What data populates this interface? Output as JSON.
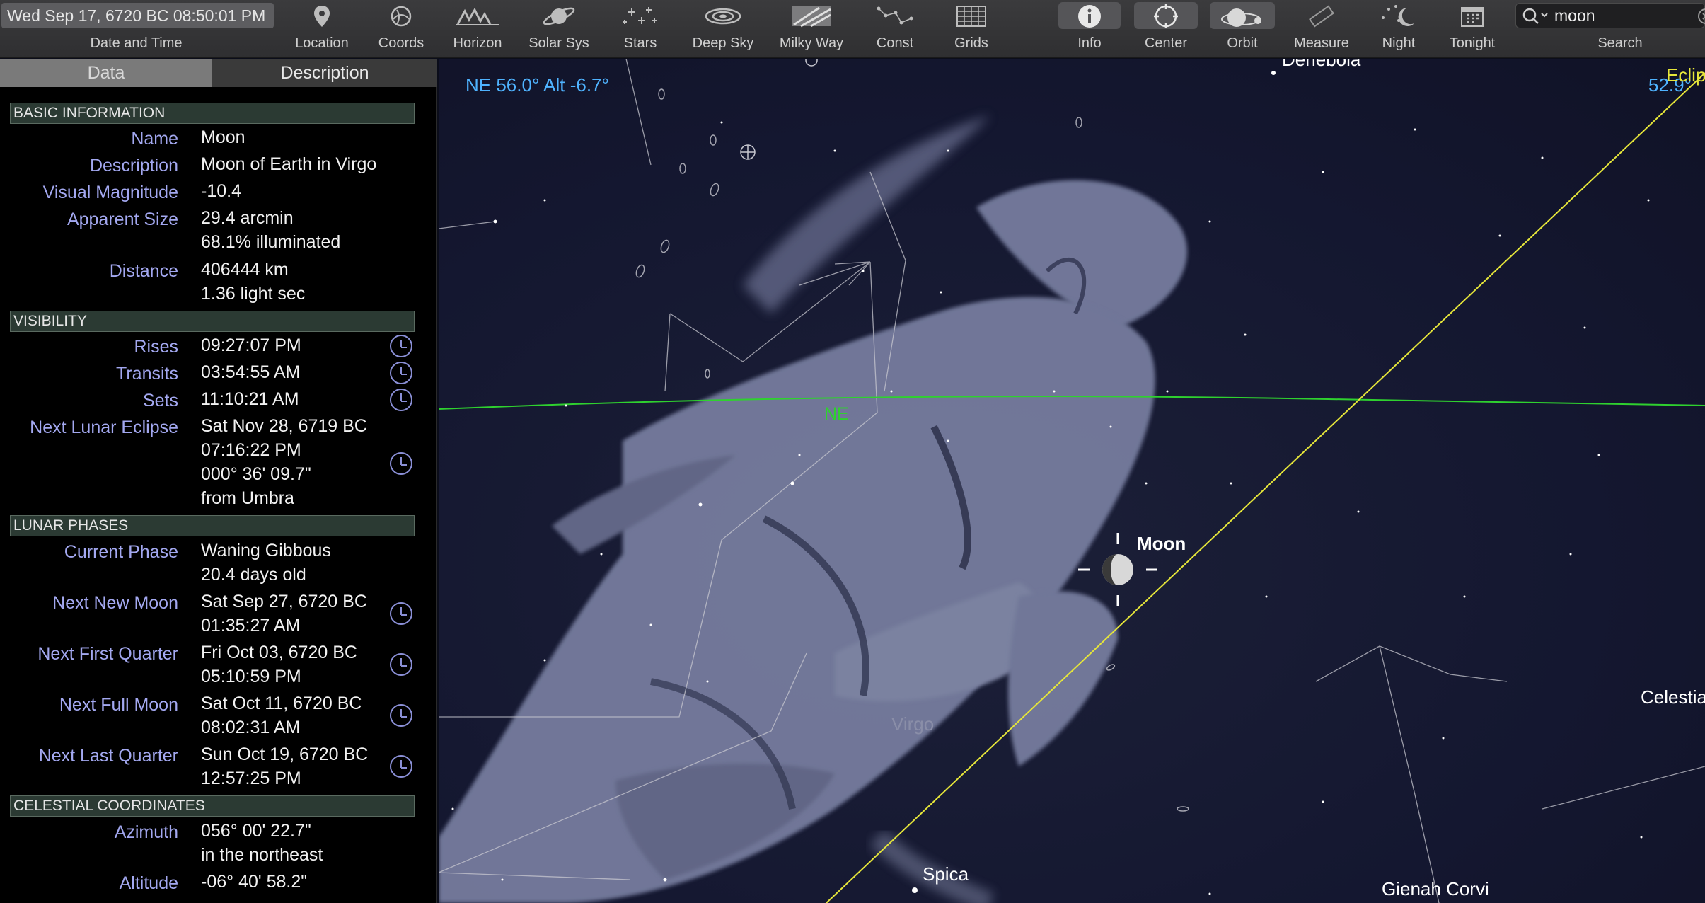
{
  "toolbar": {
    "datetime": "Wed Sep 17, 6720 BC 08:50:01 PM",
    "datetime_caption": "Date and Time",
    "buttons": [
      {
        "label": "Location",
        "icon": "location-pin-icon"
      },
      {
        "label": "Coords",
        "icon": "coordinates-icon"
      },
      {
        "label": "Horizon",
        "icon": "horizon-icon"
      },
      {
        "label": "Solar Sys",
        "icon": "planet-icon"
      },
      {
        "label": "Stars",
        "icon": "stars-icon"
      },
      {
        "label": "Deep Sky",
        "icon": "galaxy-icon"
      },
      {
        "label": "Milky Way",
        "icon": "milky-way-icon"
      },
      {
        "label": "Const",
        "icon": "constellation-icon"
      },
      {
        "label": "Grids",
        "icon": "grid-icon"
      },
      {
        "label": "Info",
        "icon": "info-icon"
      },
      {
        "label": "Center",
        "icon": "center-icon"
      },
      {
        "label": "Orbit",
        "icon": "orbit-icon"
      },
      {
        "label": "Measure",
        "icon": "ruler-icon"
      },
      {
        "label": "Night",
        "icon": "night-moon-icon"
      },
      {
        "label": "Tonight",
        "icon": "calendar-icon"
      }
    ],
    "search": {
      "value": "moon",
      "caption": "Search"
    }
  },
  "panel": {
    "tabs": [
      "Data",
      "Description"
    ],
    "sections": {
      "basic": "BASIC INFORMATION",
      "visibility": "VISIBILITY",
      "phases": "LUNAR PHASES",
      "coords": "CELESTIAL COORDINATES"
    },
    "rows": {
      "name": {
        "label": "Name",
        "value": "Moon"
      },
      "description": {
        "label": "Description",
        "value": "Moon of Earth in Virgo"
      },
      "magnitude": {
        "label": "Visual Magnitude",
        "value": "-10.4"
      },
      "size": {
        "label": "Apparent Size",
        "value": "29.4 arcmin\n68.1% illuminated"
      },
      "distance": {
        "label": "Distance",
        "value": "406444 km\n1.36 light sec"
      },
      "rises": {
        "label": "Rises",
        "value": "09:27:07 PM"
      },
      "transits": {
        "label": "Transits",
        "value": "03:54:55 AM"
      },
      "sets": {
        "label": "Sets",
        "value": "11:10:21 AM"
      },
      "eclipse": {
        "label": "Next Lunar Eclipse",
        "value": "Sat Nov 28, 6719 BC\n07:16:22 PM\n000° 36' 09.7\"\nfrom Umbra"
      },
      "phase": {
        "label": "Current Phase",
        "value": "Waning Gibbous\n20.4 days old"
      },
      "new_moon": {
        "label": "Next New Moon",
        "value": "Sat Sep 27, 6720 BC\n01:35:27 AM"
      },
      "first_quarter": {
        "label": "Next First Quarter",
        "value": "Fri Oct 03, 6720 BC\n05:10:59 PM"
      },
      "full_moon": {
        "label": "Next Full Moon",
        "value": "Sat Oct 11, 6720 BC\n08:02:31 AM"
      },
      "last_quarter": {
        "label": "Next Last Quarter",
        "value": "Sun Oct 19, 6720 BC\n12:57:25 PM"
      },
      "azimuth": {
        "label": "Azimuth",
        "value": "056° 00' 22.7\"\nin the northeast"
      },
      "altitude": {
        "label": "Altitude",
        "value": "-06° 40' 58.2\""
      }
    }
  },
  "sky": {
    "readout": "NE 56.0° Alt -6.7°",
    "readout_right": "52.9°",
    "ecliptic_label": "Eclip",
    "horizon_label": "NE",
    "labels": {
      "moon": "Moon",
      "virgo": "Virgo",
      "spica": "Spica",
      "gienah": "Gienah Corvi",
      "celestia": "Celestia",
      "denebola": "Denebola"
    },
    "colors": {
      "horizon": "#2fd12f",
      "ecliptic": "#e6e63a",
      "readout": "#4fb3ff",
      "constellation_lines": "#c8c8d0"
    }
  }
}
